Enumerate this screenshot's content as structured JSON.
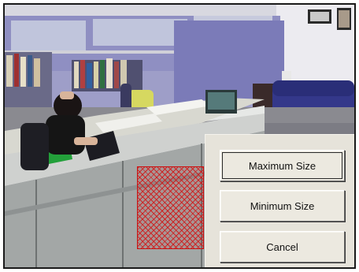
{
  "camera_view": {
    "description_icon": "camera-feed-image"
  },
  "mask": {
    "color": "#d01414",
    "pattern": "crosshatch"
  },
  "size_menu": {
    "buttons": [
      {
        "id": "maximum",
        "label": "Maximum Size",
        "focused": true
      },
      {
        "id": "minimum",
        "label": "Minimum Size",
        "focused": false
      },
      {
        "id": "cancel",
        "label": "Cancel",
        "focused": false
      }
    ]
  },
  "colors": {
    "panel_bg": "#e6e3da",
    "button_bg": "#ece9e0",
    "mask_red": "#d01414"
  }
}
